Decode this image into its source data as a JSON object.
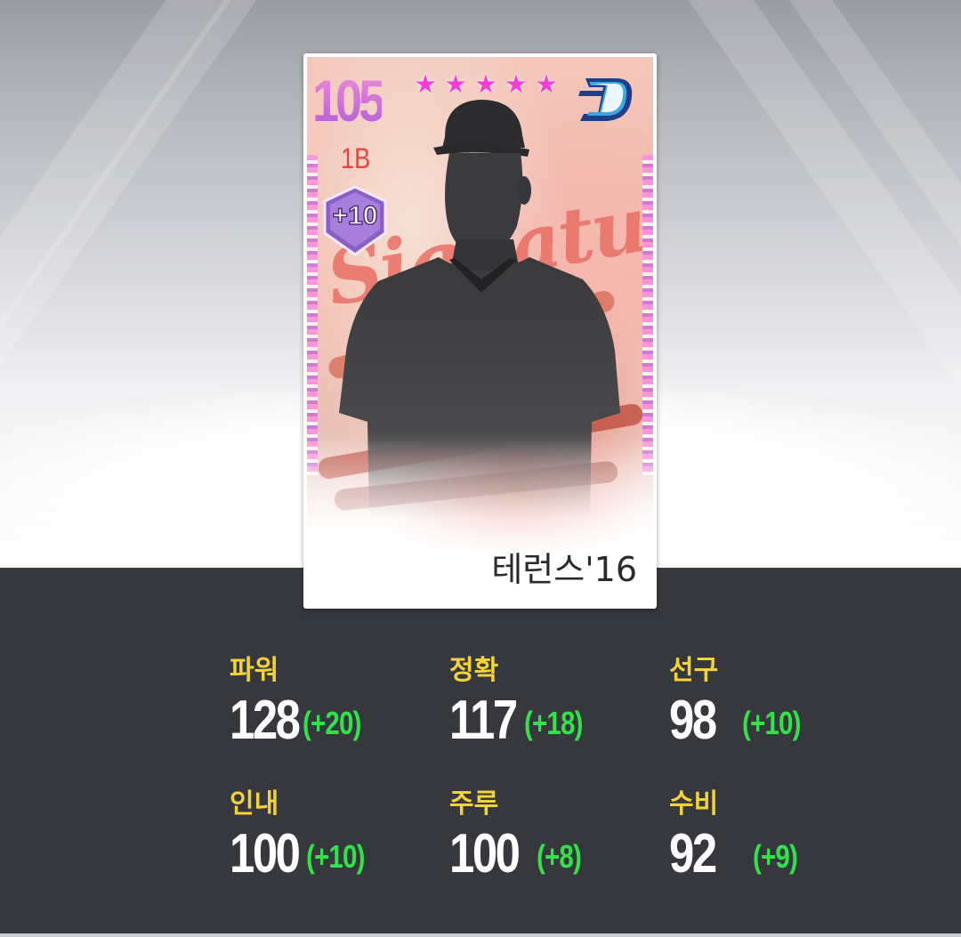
{
  "card": {
    "overall": "105",
    "position": "1B",
    "stars": [
      "★",
      "★",
      "★",
      "★",
      "★"
    ],
    "upgrade_badge": "+10",
    "series_script": "Signature",
    "player_name": "테런스'16",
    "team_logo_icon": "team-d-logo-icon",
    "colors": {
      "overall": "#d86bd6",
      "position": "#e0473f",
      "star": "#f53cd9"
    }
  },
  "stats": [
    {
      "label": "파워",
      "value": "128",
      "bonus": "(+20)"
    },
    {
      "label": "정확",
      "value": "117",
      "bonus": "(+18)"
    },
    {
      "label": "선구",
      "value": "98",
      "bonus": "(+10)"
    },
    {
      "label": "인내",
      "value": "100",
      "bonus": "(+10)"
    },
    {
      "label": "주루",
      "value": "100",
      "bonus": "(+8)"
    },
    {
      "label": "수비",
      "value": "92",
      "bonus": "(+9)"
    }
  ],
  "colors": {
    "label": "#f3d338",
    "value": "#ffffff",
    "bonus": "#31e24a",
    "panel": "#36383e"
  }
}
